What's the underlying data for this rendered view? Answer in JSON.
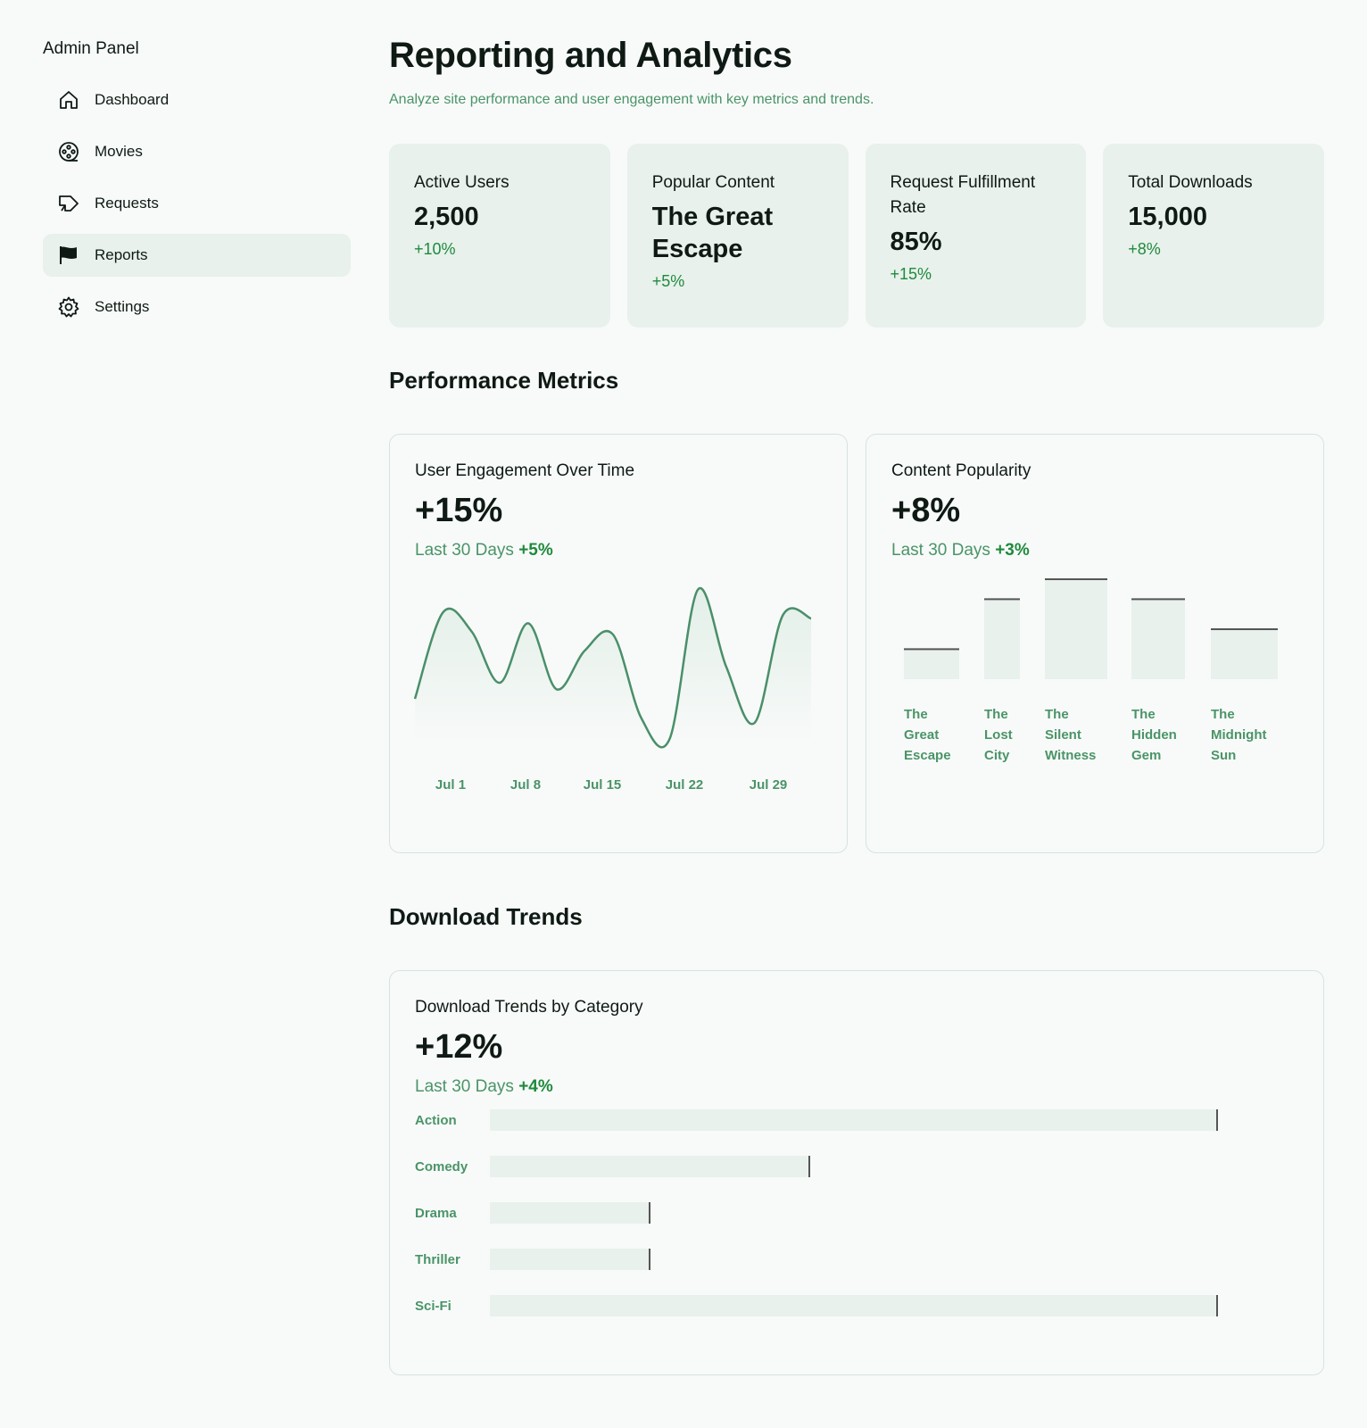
{
  "sidebar": {
    "title": "Admin Panel",
    "items": [
      {
        "label": "Dashboard",
        "icon": "home-icon",
        "active": false
      },
      {
        "label": "Movies",
        "icon": "film-reel-icon",
        "active": false
      },
      {
        "label": "Requests",
        "icon": "megaphone-icon",
        "active": false
      },
      {
        "label": "Reports",
        "icon": "flag-icon",
        "active": true
      },
      {
        "label": "Settings",
        "icon": "gear-icon",
        "active": false
      }
    ]
  },
  "header": {
    "title": "Reporting and Analytics",
    "subtitle": "Analyze site performance and user engagement with key metrics and trends."
  },
  "stats": [
    {
      "label": "Active Users",
      "value": "2,500",
      "change": "+10%"
    },
    {
      "label": "Popular Content",
      "value": "The Great Escape",
      "change": "+5%"
    },
    {
      "label": "Request Fulfillment Rate",
      "value": "85%",
      "change": "+15%"
    },
    {
      "label": "Total Downloads",
      "value": "15,000",
      "change": "+8%"
    }
  ],
  "performance": {
    "section_title": "Performance Metrics",
    "engagement": {
      "title": "User Engagement Over Time",
      "value": "+15%",
      "period": "Last 30 Days",
      "change": "+5%"
    },
    "popularity": {
      "title": "Content Popularity",
      "value": "+8%",
      "period": "Last 30 Days",
      "change": "+3%"
    }
  },
  "downloads": {
    "section_title": "Download Trends",
    "title": "Download Trends by Category",
    "value": "+12%",
    "period": "Last 30 Days",
    "change": "+4%"
  },
  "colors": {
    "accent": "#4a9468",
    "positive": "#1f8a3c",
    "card_bg": "#e8f1ec",
    "line": "#4a8f6a"
  },
  "chart_data": [
    {
      "type": "area",
      "title": "User Engagement Over Time",
      "x_tick_labels": [
        "Jul 1",
        "Jul 8",
        "Jul 15",
        "Jul 22",
        "Jul 29"
      ],
      "x": [
        0,
        1,
        2,
        3,
        4,
        5,
        6,
        7,
        8,
        9,
        10,
        11,
        12,
        13,
        14
      ],
      "values": [
        30,
        84,
        72,
        40,
        77,
        36,
        60,
        70,
        18,
        5,
        98,
        50,
        15,
        82,
        80
      ],
      "ylim": [
        0,
        100
      ],
      "grid": false
    },
    {
      "type": "bar",
      "title": "Content Popularity",
      "categories": [
        "The Great Escape",
        "The Lost City",
        "The Silent Witness",
        "The Hidden Gem",
        "The Midnight Sun"
      ],
      "values": [
        30,
        80,
        100,
        80,
        50
      ],
      "ylim": [
        0,
        100
      ],
      "grid": false
    },
    {
      "type": "bar",
      "orientation": "horizontal",
      "title": "Download Trends by Category",
      "categories": [
        "Action",
        "Comedy",
        "Drama",
        "Thriller",
        "Sci-Fi"
      ],
      "values": [
        100,
        44,
        22,
        22,
        100
      ],
      "xlim": [
        0,
        100
      ],
      "grid": false
    }
  ]
}
